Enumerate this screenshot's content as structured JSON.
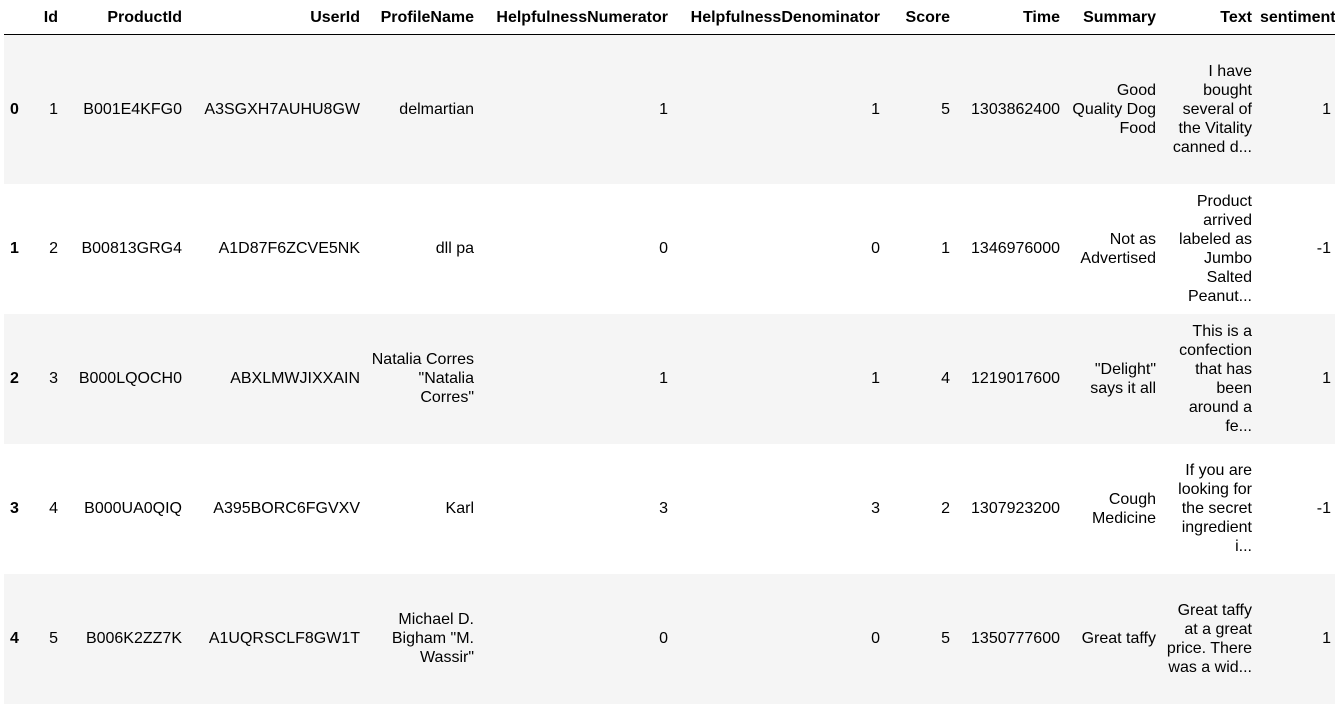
{
  "columns": [
    "",
    "Id",
    "ProductId",
    "UserId",
    "ProfileName",
    "HelpfulnessNumerator",
    "HelpfulnessDenominator",
    "Score",
    "Time",
    "Summary",
    "Text",
    "sentiment"
  ],
  "rows": [
    {
      "idx": "0",
      "Id": "1",
      "ProductId": "B001E4KFG0",
      "UserId": "A3SGXH7AUHU8GW",
      "ProfileName": "delmartian",
      "HelpfulnessNumerator": "1",
      "HelpfulnessDenominator": "1",
      "Score": "5",
      "Time": "1303862400",
      "Summary": "Good Quality Dog Food",
      "Text": "I have bought several of the Vitality canned d...",
      "sentiment": "1"
    },
    {
      "idx": "1",
      "Id": "2",
      "ProductId": "B00813GRG4",
      "UserId": "A1D87F6ZCVE5NK",
      "ProfileName": "dll pa",
      "HelpfulnessNumerator": "0",
      "HelpfulnessDenominator": "0",
      "Score": "1",
      "Time": "1346976000",
      "Summary": "Not as Advertised",
      "Text": "Product arrived labeled as Jumbo Salted Peanut...",
      "sentiment": "-1"
    },
    {
      "idx": "2",
      "Id": "3",
      "ProductId": "B000LQOCH0",
      "UserId": "ABXLMWJIXXAIN",
      "ProfileName": "Natalia Corres \"Natalia Corres\"",
      "HelpfulnessNumerator": "1",
      "HelpfulnessDenominator": "1",
      "Score": "4",
      "Time": "1219017600",
      "Summary": "\"Delight\" says it all",
      "Text": "This is a confection that has been around a fe...",
      "sentiment": "1"
    },
    {
      "idx": "3",
      "Id": "4",
      "ProductId": "B000UA0QIQ",
      "UserId": "A395BORC6FGVXV",
      "ProfileName": "Karl",
      "HelpfulnessNumerator": "3",
      "HelpfulnessDenominator": "3",
      "Score": "2",
      "Time": "1307923200",
      "Summary": "Cough Medicine",
      "Text": "If you are looking for the secret ingredient i...",
      "sentiment": "-1"
    },
    {
      "idx": "4",
      "Id": "5",
      "ProductId": "B006K2ZZ7K",
      "UserId": "A1UQRSCLF8GW1T",
      "ProfileName": "Michael D. Bigham \"M. Wassir\"",
      "HelpfulnessNumerator": "0",
      "HelpfulnessDenominator": "0",
      "Score": "5",
      "Time": "1350777600",
      "Summary": "Great taffy",
      "Text": "Great taffy at a great price. There was a wid...",
      "sentiment": "1"
    }
  ]
}
